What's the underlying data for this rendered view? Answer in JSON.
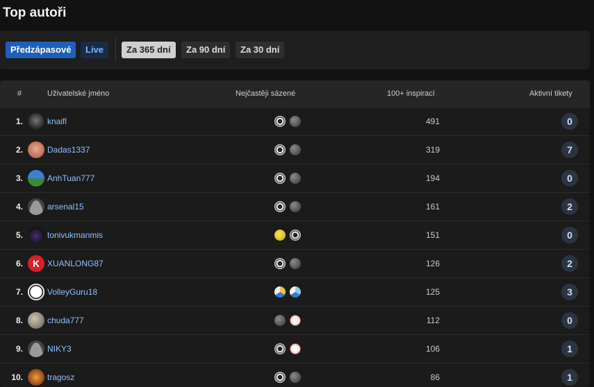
{
  "page": {
    "title": "Top autoři"
  },
  "filters": {
    "predzapasove": "Předzápasové",
    "live": "Live",
    "periods": [
      "Za 365 dní",
      "Za 90 dní",
      "Za 30 dní"
    ]
  },
  "table": {
    "headers": {
      "rank": "#",
      "username": "Uživatelské jméno",
      "sports": "Nejčastěji sázené",
      "inspirations": "100+ inspirací",
      "tickets": "Aktivní tikety"
    },
    "rows": [
      {
        "rank": "1.",
        "username": "knaifl",
        "sports": [
          "soccer",
          "other"
        ],
        "inspirations": "491",
        "tickets": "0"
      },
      {
        "rank": "2.",
        "username": "Dadas1337",
        "sports": [
          "soccer",
          "other"
        ],
        "inspirations": "319",
        "tickets": "7"
      },
      {
        "rank": "3.",
        "username": "AnhTuan777",
        "sports": [
          "soccer",
          "other"
        ],
        "inspirations": "194",
        "tickets": "0"
      },
      {
        "rank": "4.",
        "username": "arsenal15",
        "sports": [
          "soccer",
          "other"
        ],
        "inspirations": "161",
        "tickets": "2"
      },
      {
        "rank": "5.",
        "username": "tonivukmanmis",
        "sports": [
          "tennis",
          "soccer"
        ],
        "inspirations": "151",
        "tickets": "0"
      },
      {
        "rank": "6.",
        "username": "XUANLONG87",
        "sports": [
          "soccer",
          "other"
        ],
        "inspirations": "126",
        "tickets": "2"
      },
      {
        "rank": "7.",
        "username": "VolleyGuru18",
        "sports": [
          "volleyball",
          "volleyball"
        ],
        "inspirations": "125",
        "tickets": "3"
      },
      {
        "rank": "8.",
        "username": "chuda777",
        "sports": [
          "other",
          "baseball"
        ],
        "inspirations": "112",
        "tickets": "0"
      },
      {
        "rank": "9.",
        "username": "NIKY3",
        "sports": [
          "soccer",
          "baseball"
        ],
        "inspirations": "106",
        "tickets": "1"
      },
      {
        "rank": "10.",
        "username": "tragosz",
        "sports": [
          "soccer",
          "other"
        ],
        "inspirations": "86",
        "tickets": "1"
      }
    ]
  },
  "colors": {
    "accent": "#1f5fb8",
    "username": "#8fc0ff",
    "badge_bg": "#2a3442"
  }
}
